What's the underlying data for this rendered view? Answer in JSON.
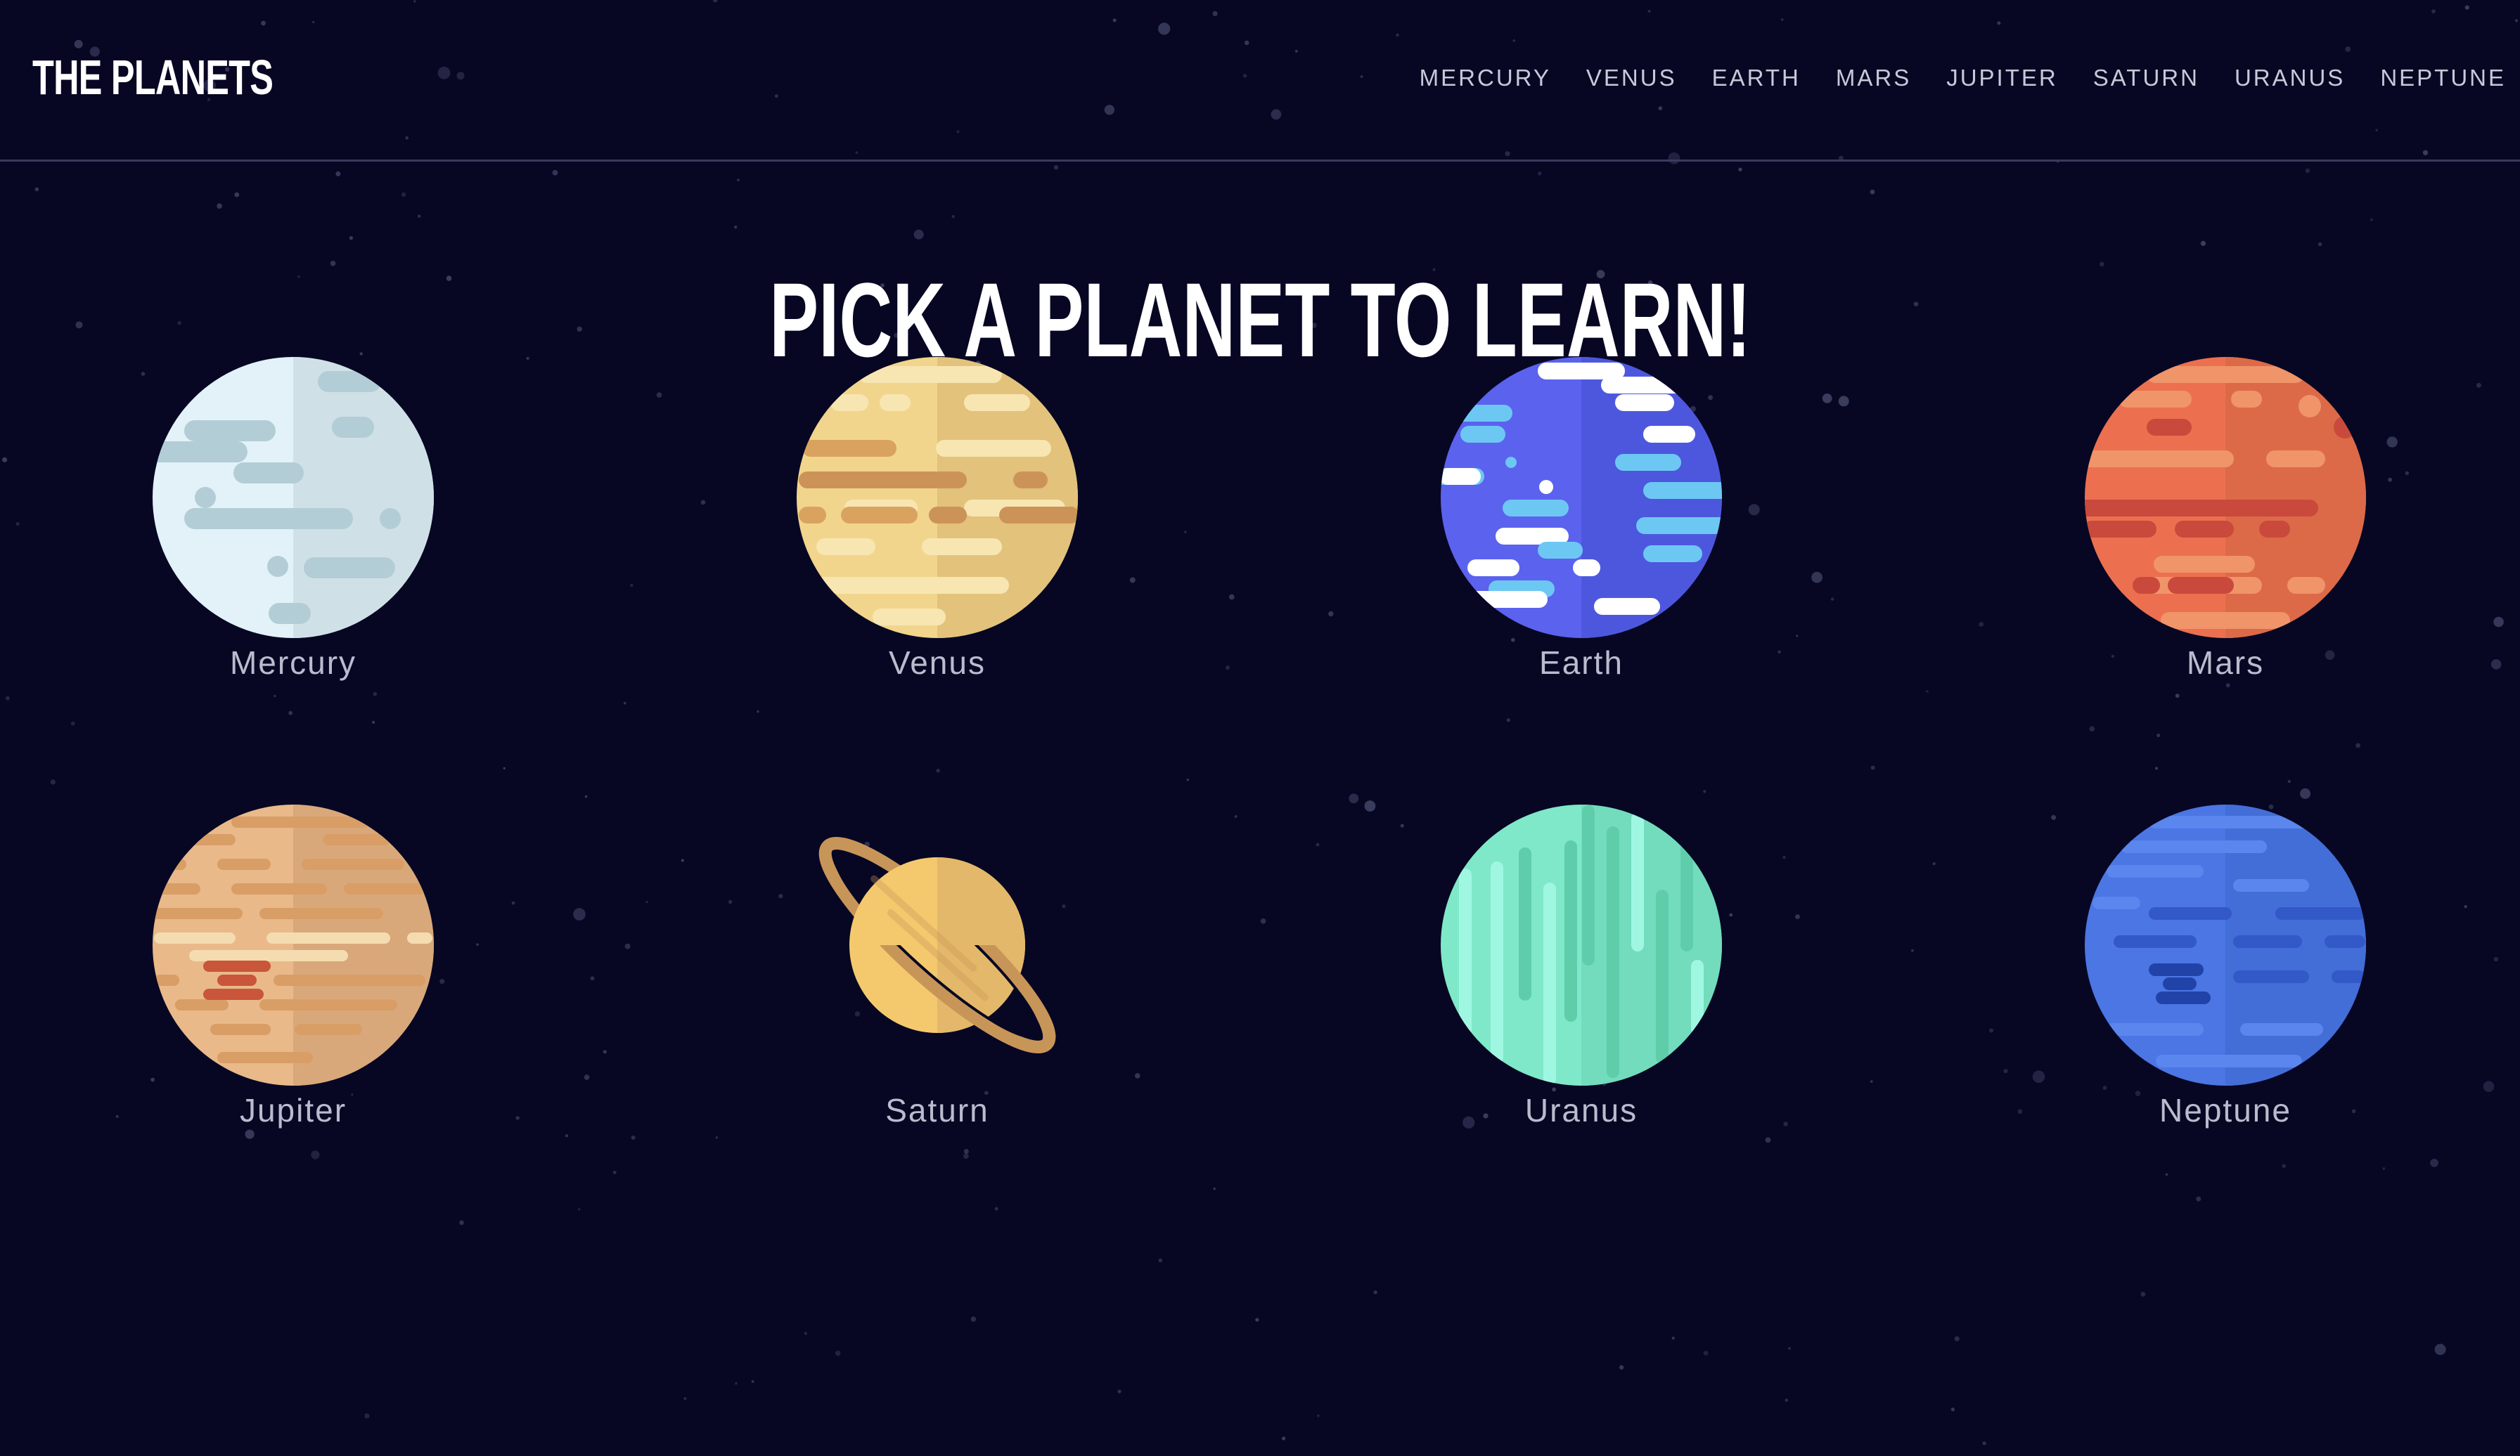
{
  "header": {
    "logo": "THE PLANETS",
    "nav": [
      "MERCURY",
      "VENUS",
      "EARTH",
      "MARS",
      "JUPITER",
      "SATURN",
      "URANUS",
      "NEPTUNE"
    ]
  },
  "main": {
    "headline": "PICK A PLANET TO LEARN!",
    "planets": [
      {
        "name": "Mercury",
        "icon": "mercury-icon"
      },
      {
        "name": "Venus",
        "icon": "venus-icon"
      },
      {
        "name": "Earth",
        "icon": "earth-icon"
      },
      {
        "name": "Mars",
        "icon": "mars-icon"
      },
      {
        "name": "Jupiter",
        "icon": "jupiter-icon"
      },
      {
        "name": "Saturn",
        "icon": "saturn-icon"
      },
      {
        "name": "Uranus",
        "icon": "uranus-icon"
      },
      {
        "name": "Neptune",
        "icon": "neptune-icon"
      }
    ]
  },
  "colors": {
    "background": "#070724",
    "divider": "#3a3b5c",
    "nav_text": "#c7c9d9",
    "label_text": "#b9bccd"
  }
}
